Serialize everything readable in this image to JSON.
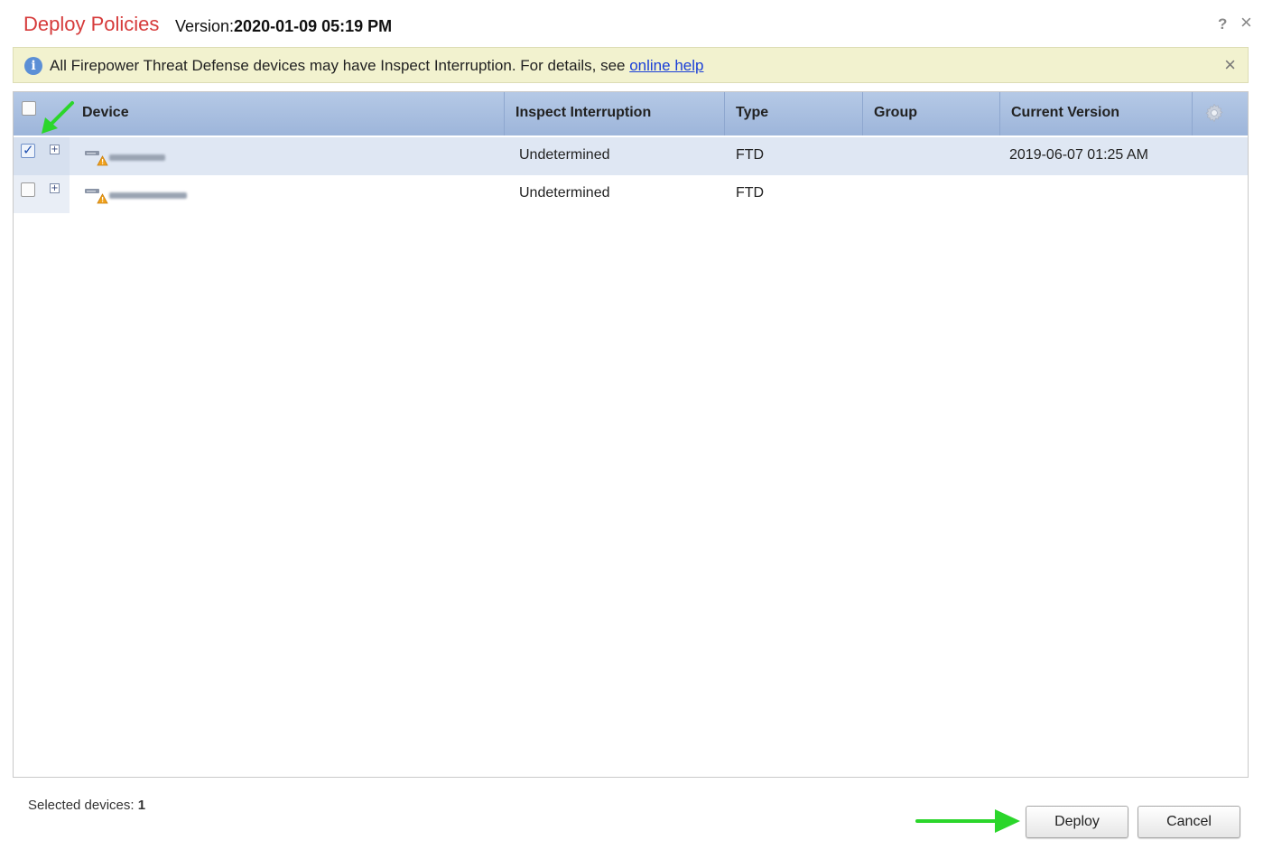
{
  "dialog": {
    "title": "Deploy Policies",
    "version_label": "Version:",
    "version_value": "2020-01-09 05:19 PM"
  },
  "banner": {
    "text": "All Firepower Threat Defense devices may have Inspect Interruption. For details, see ",
    "link_text": "online help"
  },
  "table": {
    "columns": [
      "Device",
      "Inspect Interruption",
      "Type",
      "Group",
      "Current Version"
    ],
    "rows": [
      {
        "checked": true,
        "inspect_interruption": "Undetermined",
        "type": "FTD",
        "group": "",
        "current_version": "2019-06-07 01:25 AM"
      },
      {
        "checked": false,
        "inspect_interruption": "Undetermined",
        "type": "FTD",
        "group": "",
        "current_version": ""
      }
    ]
  },
  "footer": {
    "selected_label": "Selected devices:",
    "selected_count": "1",
    "deploy_label": "Deploy",
    "cancel_label": "Cancel"
  },
  "colors": {
    "title": "#d63b3b",
    "banner_bg": "#f2f2cf",
    "header_bg": "#9db5da",
    "selected_row": "#dfe7f3",
    "link": "#1a3fd8",
    "annotation_arrow": "#2bd62b"
  },
  "icons": [
    "help-icon",
    "close-icon",
    "info-icon",
    "gear-icon",
    "expand-icon",
    "device-warning-icon"
  ]
}
